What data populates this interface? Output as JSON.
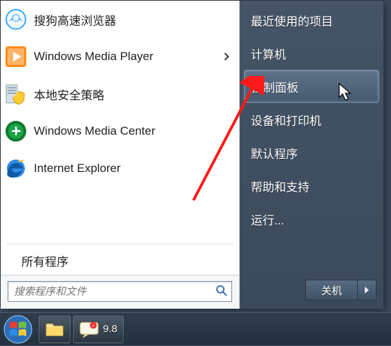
{
  "left": {
    "programs": [
      {
        "label": "搜狗高速浏览器",
        "hasSubmenu": false
      },
      {
        "label": "Windows Media Player",
        "hasSubmenu": true
      },
      {
        "label": "本地安全策略",
        "hasSubmenu": false
      },
      {
        "label": "Windows Media Center",
        "hasSubmenu": false
      },
      {
        "label": "Internet Explorer",
        "hasSubmenu": false
      }
    ],
    "allPrograms": "所有程序",
    "searchPlaceholder": "搜索程序和文件"
  },
  "right": {
    "items": [
      {
        "label": "最近使用的项目"
      },
      {
        "label": "计算机"
      },
      {
        "label": "控制面板",
        "highlight": true
      },
      {
        "label": "设备和打印机"
      },
      {
        "label": "默认程序"
      },
      {
        "label": "帮助和支持"
      },
      {
        "label": "运行..."
      }
    ],
    "shutdownLabel": "关机"
  },
  "taskbar": {
    "number": "9.8"
  }
}
